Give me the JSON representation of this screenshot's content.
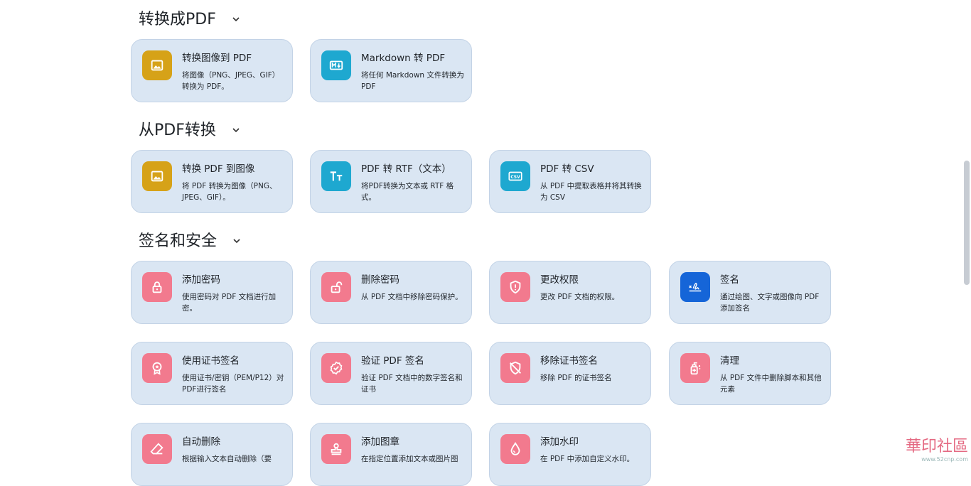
{
  "sections": [
    {
      "title": "转换成PDF"
    },
    {
      "title": "从PDF转换"
    },
    {
      "title": "签名和安全"
    }
  ],
  "cards": [
    {
      "title": "转换图像到 PDF",
      "desc": "将图像（PNG、JPEG、GIF）转换为 PDF。",
      "icon": "image-icon",
      "color": "#d6a218"
    },
    {
      "title": "Markdown 转 PDF",
      "desc": "将任何 Markdown 文件转换为 PDF",
      "icon": "markdown-icon",
      "color": "#1ea8d0"
    },
    {
      "title": "转换 PDF 到图像",
      "desc": "将 PDF 转换为图像（PNG、JPEG、GIF）。",
      "icon": "image-icon",
      "color": "#d6a218"
    },
    {
      "title": "PDF 转 RTF（文本）",
      "desc": "将PDF转换为文本或 RTF 格式。",
      "icon": "text-format-icon",
      "color": "#1ea8d0"
    },
    {
      "title": "PDF 转 CSV",
      "desc": "从 PDF 中提取表格并将其转换为 CSV",
      "icon": "csv-icon",
      "color": "#1ea8d0"
    },
    {
      "title": "添加密码",
      "desc": "使用密码对 PDF 文档进行加密。",
      "icon": "lock-icon",
      "color": "#f27a8e"
    },
    {
      "title": "删除密码",
      "desc": "从 PDF 文档中移除密码保护。",
      "icon": "unlock-icon",
      "color": "#f27a8e"
    },
    {
      "title": "更改权限",
      "desc": "更改 PDF 文档的权限。",
      "icon": "shield-icon",
      "color": "#f27a8e"
    },
    {
      "title": "签名",
      "desc": "通过绘图、文字或图像向 PDF 添加签名",
      "icon": "signature-icon",
      "color": "#1565d8"
    },
    {
      "title": "使用证书签名",
      "desc": "使用证书/密钥（PEM/P12）对PDF进行签名",
      "icon": "certificate-icon",
      "color": "#f27a8e"
    },
    {
      "title": "验证 PDF 签名",
      "desc": "验证 PDF 文档中的数字签名和证书",
      "icon": "verified-icon",
      "color": "#f27a8e"
    },
    {
      "title": "移除证书签名",
      "desc": "移除 PDF 的证书签名",
      "icon": "shield-off-icon",
      "color": "#f27a8e"
    },
    {
      "title": "清理",
      "desc": "从 PDF 文件中删除脚本和其他元素",
      "icon": "sanitize-icon",
      "color": "#f27a8e"
    },
    {
      "title": "自动删除",
      "desc": "根据输入文本自动删除（要",
      "icon": "eraser-icon",
      "color": "#f27a8e"
    },
    {
      "title": "添加图章",
      "desc": "在指定位置添加文本或图片图",
      "icon": "stamp-icon",
      "color": "#f27a8e"
    },
    {
      "title": "添加水印",
      "desc": "在 PDF 中添加自定义水印。",
      "icon": "drop-icon",
      "color": "#f27a8e"
    }
  ],
  "watermark": {
    "text": "華印社區",
    "url": "www.52cnp.com"
  }
}
